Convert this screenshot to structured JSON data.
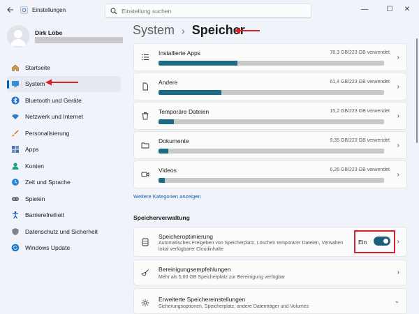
{
  "window": {
    "title": "Einstellungen",
    "search_placeholder": "Einstellung suchen",
    "controls": {
      "minimize": "—",
      "maximize": "☐",
      "close": "✕"
    }
  },
  "profile": {
    "name": "Dirk Löbe"
  },
  "sidebar": {
    "items": [
      {
        "label": "Startseite",
        "icon": "home-icon"
      },
      {
        "label": "System",
        "icon": "display-icon",
        "active": true
      },
      {
        "label": "Bluetooth und Geräte",
        "icon": "bluetooth-icon"
      },
      {
        "label": "Netzwerk und Internet",
        "icon": "wifi-icon"
      },
      {
        "label": "Personalisierung",
        "icon": "brush-icon"
      },
      {
        "label": "Apps",
        "icon": "apps-icon"
      },
      {
        "label": "Konten",
        "icon": "person-icon"
      },
      {
        "label": "Zeit und Sprache",
        "icon": "globe-clock-icon"
      },
      {
        "label": "Spielen",
        "icon": "gamepad-icon"
      },
      {
        "label": "Barrierefreiheit",
        "icon": "accessibility-icon"
      },
      {
        "label": "Datenschutz und Sicherheit",
        "icon": "shield-icon"
      },
      {
        "label": "Windows Update",
        "icon": "update-icon"
      }
    ]
  },
  "breadcrumb": {
    "parent": "System",
    "separator": "›",
    "current": "Speicher"
  },
  "storage": [
    {
      "name": "Installierte Apps",
      "usage": "78,3 GB/223 GB verwendet",
      "fraction": 0.35,
      "icon": "list-icon"
    },
    {
      "name": "Andere",
      "usage": "61,4 GB/223 GB verwendet",
      "fraction": 0.28,
      "icon": "document-icon"
    },
    {
      "name": "Temporäre Dateien",
      "usage": "15,2 GB/223 GB verwendet",
      "fraction": 0.068,
      "icon": "trash-icon"
    },
    {
      "name": "Dokumente",
      "usage": "9,35 GB/223 GB verwendet",
      "fraction": 0.042,
      "icon": "folder-icon"
    },
    {
      "name": "Videos",
      "usage": "6,26 GB/223 GB verwendet",
      "fraction": 0.028,
      "icon": "video-icon"
    }
  ],
  "more_categories": "Weitere Kategorien anzeigen",
  "management": {
    "section_title": "Speicherverwaltung",
    "optimizer": {
      "title": "Speicheroptimierung",
      "desc_line1": "Automatisches Freigeben von Speicherplatz, Löschen temporärer Dateien, Verwalten",
      "desc_line2": "lokal verfügbarer Cloudinhalte",
      "toggle_label": "Ein",
      "toggle_on": true
    },
    "cleanup": {
      "title": "Bereinigungsempfehlungen",
      "desc": "Mehr als 5,00 GB Speicherplatz zur Bereinigung verfügbar"
    },
    "advanced": {
      "title": "Erweiterte Speichereinstellungen",
      "desc": "Sicherungsoptionen, Speicherplatz, andere Datenträger und Volumes"
    }
  },
  "colors": {
    "accent": "#1d5e78",
    "bar_fill": "#1b6b86",
    "bar_track": "#c8c8c8",
    "annotation": "#d6202a",
    "link": "#1a5fa8"
  }
}
